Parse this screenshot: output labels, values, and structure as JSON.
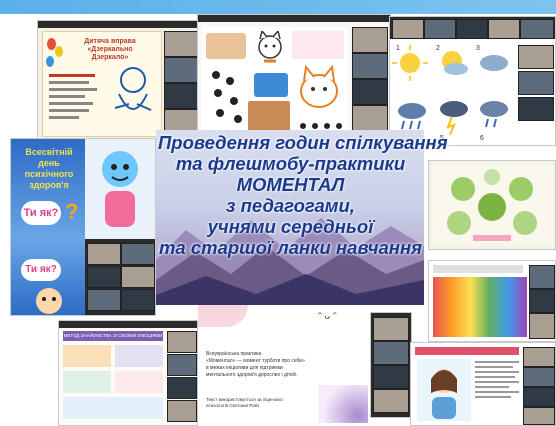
{
  "collage": {
    "main_title_lines": [
      "Проведення  годин спілкування",
      "та флешмобу-практики",
      "МОМЕНТАЛ",
      "з педагогами,",
      "учнями середньої",
      "та старшої ланки навчання"
    ],
    "top_left_slide": {
      "heading_line1": "Дитяча вправа",
      "heading_line2": "«Дзеркально",
      "heading_line3": "Дзеркало»"
    },
    "left_slide": {
      "line1": "Всесвітній день",
      "line2": "психічного",
      "line3": "здоров'я",
      "question1": "Ти як?",
      "question2": "Ти як?"
    },
    "bottom_center_slide": {
      "line1": "Всеукраїнська практика",
      "line2": "«Моментал» — момент турботи про себе»",
      "line3": "в межах ініціативи для підтримки",
      "line4": "ментального здоров'я дорослих і дітей.",
      "line5": "Текст використовується за ліцензією",
      "line6": "психологів Світлани Ройз"
    },
    "weather_numbers": [
      "1",
      "2",
      "3",
      "4",
      "5",
      "6"
    ],
    "bottom_left_slide_title": "МЕТОД ЗНАЙОМСТВА ЗІ СВОЇМИ ЕМОЦІЯМИ"
  },
  "colors": {
    "title_blue": "#1b3a8f",
    "sky_top": "#cfd5ea",
    "mountain_dark": "#3a3564",
    "mountain_mid": "#6b5a86",
    "topbar": "#2b2b2b",
    "stripe_blue": "#5ab0e8"
  }
}
